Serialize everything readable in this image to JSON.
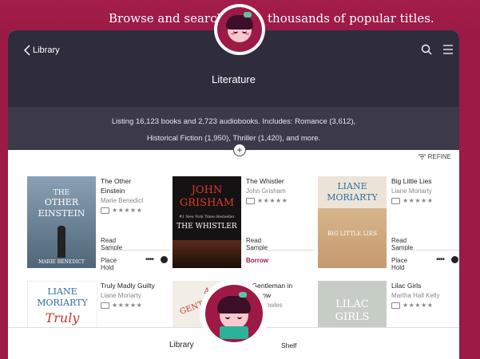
{
  "banner": {
    "left_text": "Browse and search",
    "right_text": "thousands of popular titles."
  },
  "header": {
    "back_label": "Library",
    "title": "Literature"
  },
  "description": {
    "line1": "Listing 16,123 books and 2,723 audiobooks. Includes: Romance (3,612),",
    "line2": "Historical Fiction (1,950), Thriller (1,420), and more."
  },
  "refine_label": "REFINE",
  "books": [
    {
      "title_line1": "The Other",
      "title_line2": "Einstein",
      "author": "Marie Benedict",
      "read_sample": "Read Sample",
      "action": "Place Hold",
      "cover": {
        "bg": "#6e8aa3",
        "top": "THE",
        "main": "OTHER",
        "main2": "EINSTEIN",
        "bottom": "MARIE BENEDICT"
      }
    },
    {
      "title_line1": "The Whistler",
      "title_line2": "",
      "author": "John Grisham",
      "read_sample": "Read Sample",
      "action": "Borrow",
      "cover": {
        "bg": "#1c1a1a",
        "top": "JOHN",
        "main": "GRISHAM",
        "main2": "THE WHISTLER",
        "bottom": "#1 New York Times Bestseller"
      }
    },
    {
      "title_line1": "Big Little Lies",
      "title_line2": "",
      "author": "Liane Moriarty",
      "read_sample": "Read Sample",
      "action": "Place Hold",
      "cover": {
        "bg": "#e9e0d3",
        "top": "LIANE",
        "main": "MORIARTY",
        "main2": "BIG LITTLE LIES",
        "bottom": ""
      }
    },
    {
      "title_line1": "Truly Madly Guilty",
      "title_line2": "",
      "author": "Liane Moriarty",
      "cover": {
        "bg": "#ffffff",
        "top": "LIANE",
        "main": "MORIARTY",
        "main2": "Truly",
        "bottom": ""
      }
    },
    {
      "title_line1": "A Gentleman in",
      "title_line2": "Moscow",
      "author": "Amor Towles",
      "cover": {
        "bg": "#f2ede6",
        "top": "A",
        "main": "GENTLEMAN",
        "main2": "IN",
        "bottom": ""
      }
    },
    {
      "title_line1": "Lilac Girls",
      "title_line2": "",
      "author": "Martha Hall Kelly",
      "cover": {
        "bg": "#c9cfc7",
        "top": "",
        "main": "LILAC",
        "main2": "GIRLS",
        "bottom": ""
      }
    }
  ],
  "tabs": {
    "library": "Library",
    "shelf": "Shelf"
  },
  "colors": {
    "brand": "#9c1a45",
    "header": "#2f2c3c",
    "accent": "#a31d4a"
  },
  "icons": {
    "back": "chevron-left-icon",
    "search": "search-icon",
    "menu": "hamburger-menu-icon",
    "refine": "filter-icon"
  }
}
